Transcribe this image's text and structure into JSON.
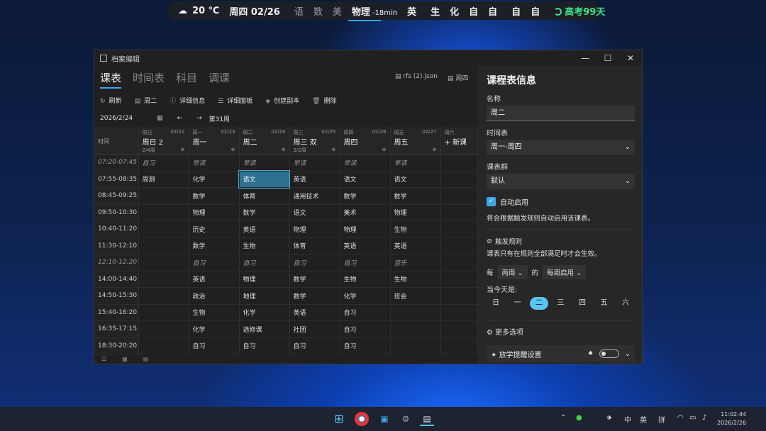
{
  "topbar": {
    "weather": "20 ℃",
    "date": "周四 02/26",
    "s1": "语",
    "s2": "数",
    "s3": "美",
    "current": "物理",
    "current_sub": "-18min",
    "s4": "英",
    "s5": "生",
    "s6": "化",
    "s7": "自",
    "s8": "自",
    "s9": "自",
    "s10": "自",
    "countdown": "高考99天",
    "accent": "#2fa3ff",
    "count_color": "#3fe08a"
  },
  "window": {
    "title": "档案编辑",
    "tabs": [
      "课表",
      "时间表",
      "科目",
      "调课"
    ],
    "file1": "rfs (2).json",
    "file2": "周四",
    "toolbar": {
      "refresh": "刷新",
      "tue": "周二",
      "detail": "详细信息",
      "panel": "详细面板",
      "create": "创建副本",
      "delete": "删除"
    },
    "date": "2026/2/24",
    "week": "第31周",
    "headers": [
      {
        "wk": "",
        "dt": "",
        "nm": "时间",
        "sm": ""
      },
      {
        "wk": "周日",
        "dt": "02/22",
        "nm": "周日 2",
        "sm": "2/4周"
      },
      {
        "wk": "周一",
        "dt": "02/23",
        "nm": "周一",
        "sm": ""
      },
      {
        "wk": "周二",
        "dt": "02/24",
        "nm": "周二",
        "sm": ""
      },
      {
        "wk": "周三",
        "dt": "02/25",
        "nm": "周三 双",
        "sm": "2/2周"
      },
      {
        "wk": "周四",
        "dt": "02/26",
        "nm": "周四",
        "sm": ""
      },
      {
        "wk": "周五",
        "dt": "02/27",
        "nm": "周五",
        "sm": ""
      },
      {
        "wk": "周六",
        "dt": "",
        "nm": "+ 新课",
        "sm": ""
      }
    ],
    "rows": [
      {
        "t": "07:20-07:45",
        "it": true,
        "c": [
          "自习",
          "早读",
          "早读",
          "早读",
          "早读",
          "早读",
          ""
        ]
      },
      {
        "t": "07:55-08:35",
        "it": false,
        "c": [
          "周测",
          "化学",
          "语文",
          "英语",
          "语文",
          "语文",
          ""
        ]
      },
      {
        "t": "08:45-09:25",
        "it": false,
        "c": [
          "",
          "数学",
          "体育",
          "通用技术",
          "数学",
          "数学",
          ""
        ]
      },
      {
        "t": "09:50-10:30",
        "it": false,
        "c": [
          "",
          "物理",
          "数学",
          "语文",
          "美术",
          "物理",
          ""
        ]
      },
      {
        "t": "10:40-11:20",
        "it": false,
        "c": [
          "",
          "历史",
          "英语",
          "物理",
          "物理",
          "生物",
          ""
        ]
      },
      {
        "t": "11:30-12:10",
        "it": false,
        "c": [
          "",
          "数学",
          "生物",
          "体育",
          "英语",
          "英语",
          ""
        ]
      },
      {
        "t": "12:10-12:20",
        "it": true,
        "c": [
          "",
          "自习",
          "自习",
          "自习",
          "自习",
          "音乐",
          ""
        ]
      },
      {
        "t": "14:00-14:40",
        "it": false,
        "c": [
          "",
          "英语",
          "物理",
          "数学",
          "生物",
          "生物",
          ""
        ]
      },
      {
        "t": "14:50-15:30",
        "it": false,
        "c": [
          "",
          "政治",
          "地理",
          "数学",
          "化学",
          "班会",
          ""
        ]
      },
      {
        "t": "15:40-16:20",
        "it": false,
        "c": [
          "",
          "生物",
          "化学",
          "英语",
          "自习",
          "",
          ""
        ]
      },
      {
        "t": "16:35-17:15",
        "it": false,
        "c": [
          "",
          "化学",
          "选修课",
          "社团",
          "自习",
          "",
          ""
        ]
      },
      {
        "t": "18:30-20:20",
        "it": false,
        "c": [
          "",
          "自习",
          "自习",
          "自习",
          "自习",
          "",
          ""
        ]
      }
    ]
  },
  "pane": {
    "title": "课程表信息",
    "name_label": "名称",
    "name_value": "周二",
    "tt_label": "时间表",
    "tt_value": "周一-周四",
    "group_label": "课表群",
    "group_value": "默认",
    "auto": "自动启用",
    "auto_note": "将会根据触发规则自动启用该课表。",
    "rules": "触发规则",
    "rules_note": "课表只有在规则全部满足时才会生效。",
    "every": "每",
    "cycle": "两周",
    "of": "的",
    "cycle2": "每周启用",
    "when": "当今天是:",
    "days": [
      "日",
      "一",
      "二",
      "三",
      "四",
      "五",
      "六"
    ],
    "active_day": 2,
    "more": "更多选项",
    "remind": "放学提醒设置"
  },
  "taskbar": {
    "ime1": "英",
    "ime2": "拼",
    "time": "11:02:44",
    "date": "2026/2/26"
  }
}
